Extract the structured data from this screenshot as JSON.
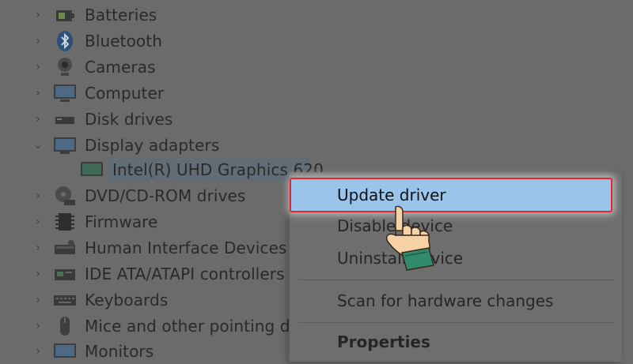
{
  "tree": {
    "items": [
      {
        "label": "Batteries",
        "icon": "battery-icon",
        "expanded": false
      },
      {
        "label": "Bluetooth",
        "icon": "bluetooth-icon",
        "expanded": false
      },
      {
        "label": "Cameras",
        "icon": "camera-icon",
        "expanded": false
      },
      {
        "label": "Computer",
        "icon": "computer-icon",
        "expanded": false
      },
      {
        "label": "Disk drives",
        "icon": "disk-drive-icon",
        "expanded": false
      },
      {
        "label": "Display adapters",
        "icon": "display-adapter-icon",
        "expanded": true
      },
      {
        "label": "Intel(R) UHD Graphics 620",
        "icon": "display-adapter-icon",
        "child": true
      },
      {
        "label": "DVD/CD-ROM drives",
        "icon": "dvd-drive-icon",
        "expanded": false
      },
      {
        "label": "Firmware",
        "icon": "firmware-icon",
        "expanded": false
      },
      {
        "label": "Human Interface Devices",
        "icon": "hid-icon",
        "expanded": false
      },
      {
        "label": "IDE ATA/ATAPI controllers",
        "icon": "ide-controller-icon",
        "expanded": false
      },
      {
        "label": "Keyboards",
        "icon": "keyboard-icon",
        "expanded": false
      },
      {
        "label": "Mice and other pointing de",
        "icon": "mouse-icon",
        "expanded": false
      },
      {
        "label": "Monitors",
        "icon": "monitor-icon",
        "expanded": false
      }
    ]
  },
  "context_menu": {
    "items": [
      {
        "label": "Update driver",
        "highlighted": true
      },
      {
        "label": "Disable device"
      },
      {
        "label": "Uninstall device"
      },
      {
        "label": "Scan for hardware changes"
      },
      {
        "label": "Properties",
        "bold": true
      }
    ]
  },
  "colors": {
    "overlay_background": "#6b6b6b",
    "highlight_fill": "#9bc4ea",
    "highlight_border": "#e3262c"
  }
}
